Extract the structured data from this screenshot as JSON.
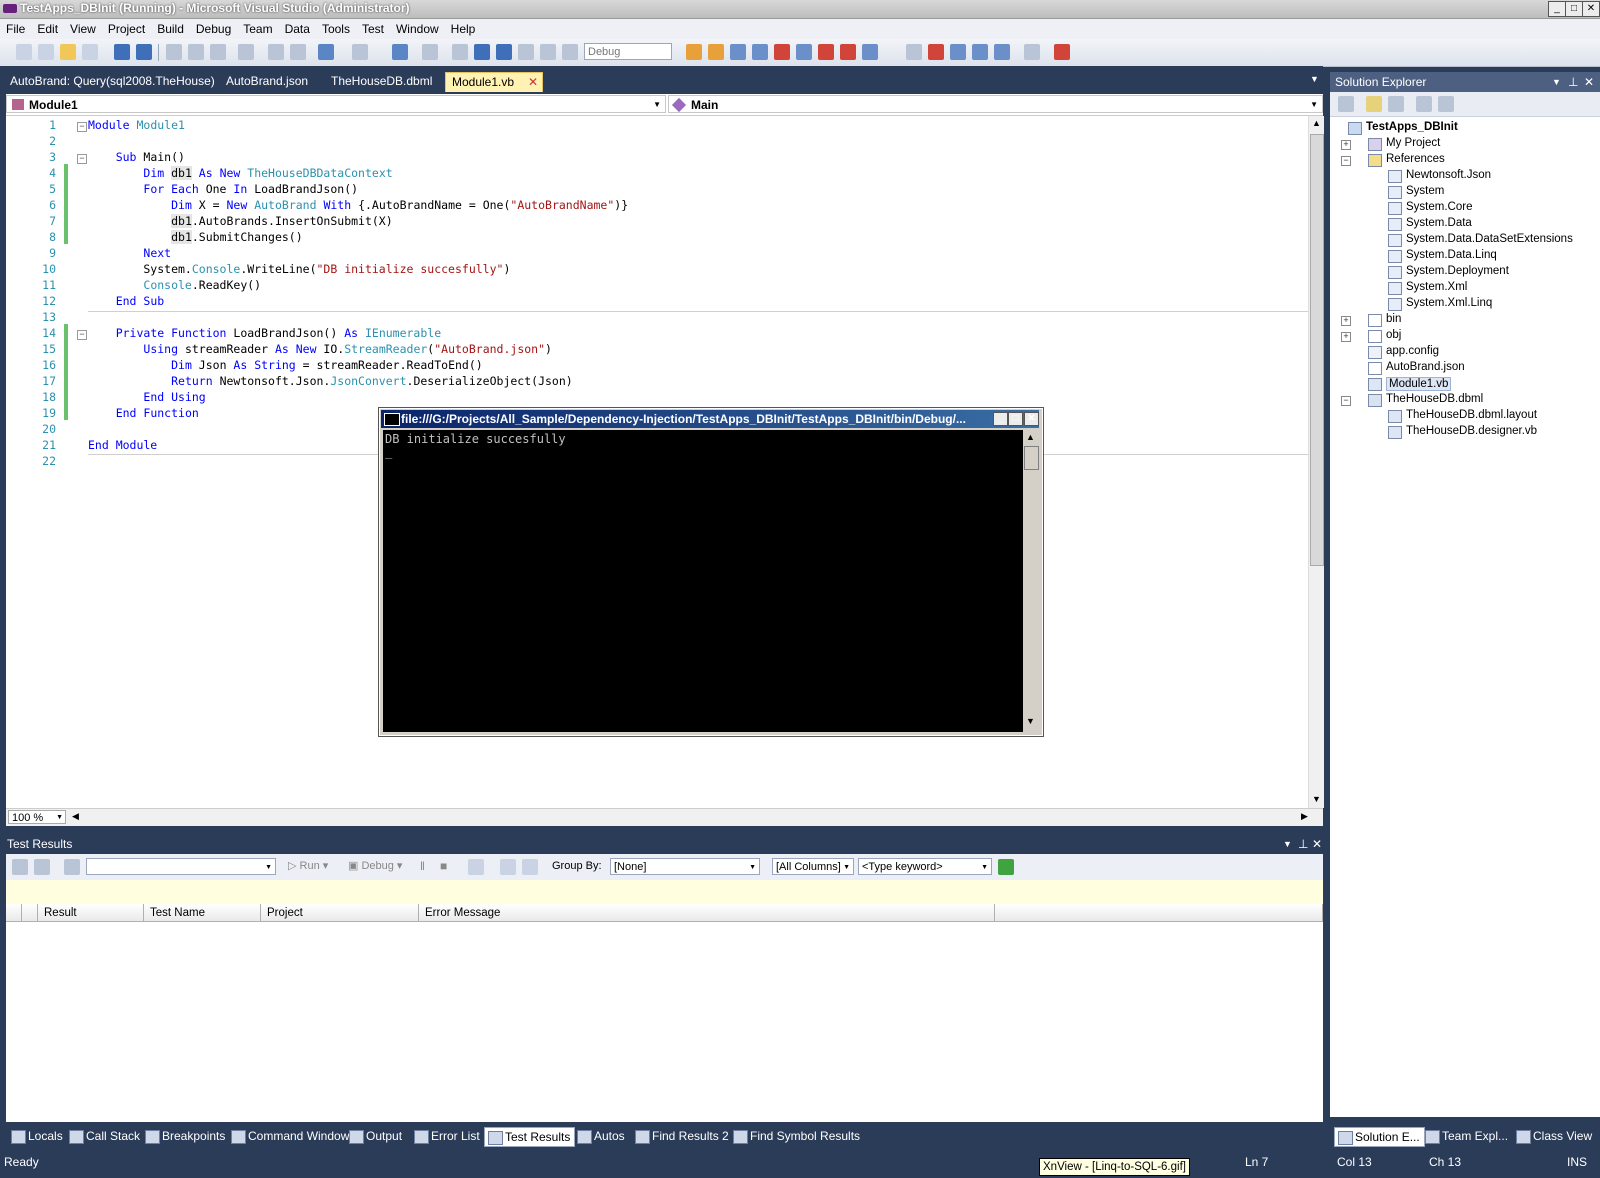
{
  "window": {
    "title": "TestApps_DBInit (Running) - Microsoft Visual Studio (Administrator)",
    "min": "_",
    "max": "□",
    "close": "✕"
  },
  "menu": [
    "File",
    "Edit",
    "View",
    "Project",
    "Build",
    "Debug",
    "Team",
    "Data",
    "Tools",
    "Test",
    "Window",
    "Help"
  ],
  "toolbar": {
    "config_combo": "Debug"
  },
  "doc_tabs": [
    {
      "label": "AutoBrand: Query(sql2008.TheHouse)",
      "active": false
    },
    {
      "label": "AutoBrand.json",
      "active": false
    },
    {
      "label": "TheHouseDB.dbml",
      "active": false
    },
    {
      "label": "Module1.vb",
      "active": true
    }
  ],
  "editor": {
    "nav_left": "Module1",
    "nav_right": "Main",
    "zoom": "100 %",
    "line_numbers": [
      "1",
      "2",
      "3",
      "4",
      "5",
      "6",
      "7",
      "8",
      "9",
      "10",
      "11",
      "12",
      "13",
      "14",
      "15",
      "16",
      "17",
      "18",
      "19",
      "20",
      "21",
      "22"
    ],
    "lines": [
      [
        [
          "kw",
          "Module "
        ],
        [
          "ty",
          "Module1"
        ]
      ],
      [],
      [
        [
          "t",
          "    "
        ],
        [
          "kw",
          "Sub "
        ],
        [
          "t",
          "Main()"
        ]
      ],
      [
        [
          "t",
          "        "
        ],
        [
          "kw",
          "Dim "
        ],
        [
          "hl",
          "db1"
        ],
        [
          "kw",
          " As New "
        ],
        [
          "ty",
          "TheHouseDBDataContext"
        ]
      ],
      [
        [
          "t",
          "        "
        ],
        [
          "kw",
          "For Each "
        ],
        [
          "t",
          "One "
        ],
        [
          "kw",
          "In "
        ],
        [
          "t",
          "LoadBrandJson()"
        ]
      ],
      [
        [
          "t",
          "            "
        ],
        [
          "kw",
          "Dim "
        ],
        [
          "t",
          "X = "
        ],
        [
          "kw",
          "New "
        ],
        [
          "ty",
          "AutoBrand "
        ],
        [
          "kw",
          "With "
        ],
        [
          "t",
          "{.AutoBrandName = One("
        ],
        [
          "st",
          "\"AutoBrandName\""
        ],
        [
          "t",
          ")}"
        ]
      ],
      [
        [
          "t",
          "            "
        ],
        [
          "hl",
          "db1"
        ],
        [
          "t",
          ".AutoBrands.InsertOnSubmit(X)"
        ]
      ],
      [
        [
          "t",
          "            "
        ],
        [
          "hl",
          "db1"
        ],
        [
          "t",
          ".SubmitChanges()"
        ]
      ],
      [
        [
          "t",
          "        "
        ],
        [
          "kw",
          "Next"
        ]
      ],
      [
        [
          "t",
          "        System."
        ],
        [
          "ty",
          "Console"
        ],
        [
          "t",
          ".WriteLine("
        ],
        [
          "st",
          "\"DB initialize succesfully\""
        ],
        [
          "t",
          ")"
        ]
      ],
      [
        [
          "t",
          "        "
        ],
        [
          "ty",
          "Console"
        ],
        [
          "t",
          ".ReadKey()"
        ]
      ],
      [
        [
          "t",
          "    "
        ],
        [
          "kw",
          "End Sub"
        ]
      ],
      [],
      [
        [
          "t",
          "    "
        ],
        [
          "kw",
          "Private Function "
        ],
        [
          "t",
          "LoadBrandJson() "
        ],
        [
          "kw",
          "As "
        ],
        [
          "ty",
          "IEnumerable"
        ]
      ],
      [
        [
          "t",
          "        "
        ],
        [
          "kw",
          "Using "
        ],
        [
          "t",
          "streamReader "
        ],
        [
          "kw",
          "As New "
        ],
        [
          "t",
          "IO."
        ],
        [
          "ty",
          "StreamReader"
        ],
        [
          "t",
          "("
        ],
        [
          "st",
          "\"AutoBrand.json\""
        ],
        [
          "t",
          ")"
        ]
      ],
      [
        [
          "t",
          "            "
        ],
        [
          "kw",
          "Dim "
        ],
        [
          "t",
          "Json "
        ],
        [
          "kw",
          "As String "
        ],
        [
          "t",
          "= streamReader.ReadToEnd()"
        ]
      ],
      [
        [
          "t",
          "            "
        ],
        [
          "kw",
          "Return "
        ],
        [
          "t",
          "Newtonsoft.Json."
        ],
        [
          "ty",
          "JsonConvert"
        ],
        [
          "t",
          ".DeserializeObject(Json)"
        ]
      ],
      [
        [
          "t",
          "        "
        ],
        [
          "kw",
          "End Using"
        ]
      ],
      [
        [
          "t",
          "    "
        ],
        [
          "kw",
          "End Function"
        ]
      ],
      [],
      [
        [
          "kw",
          "End Module"
        ]
      ],
      []
    ]
  },
  "console": {
    "title": "file:///G:/Projects/All_Sample/Dependency-Injection/TestApps_DBInit/TestApps_DBInit/bin/Debug/...",
    "output": "DB initialize succesfully",
    "cursor": "_"
  },
  "solution_explorer": {
    "title": "Solution Explorer",
    "nodes": [
      {
        "label": "TestApps_DBInit",
        "bold": true
      },
      {
        "label": "My Project"
      },
      {
        "label": "References"
      },
      {
        "label": "Newtonsoft.Json"
      },
      {
        "label": "System"
      },
      {
        "label": "System.Core"
      },
      {
        "label": "System.Data"
      },
      {
        "label": "System.Data.DataSetExtensions"
      },
      {
        "label": "System.Data.Linq"
      },
      {
        "label": "System.Deployment"
      },
      {
        "label": "System.Xml"
      },
      {
        "label": "System.Xml.Linq"
      },
      {
        "label": "bin"
      },
      {
        "label": "obj"
      },
      {
        "label": "app.config"
      },
      {
        "label": "AutoBrand.json"
      },
      {
        "label": "Module1.vb",
        "selected": true
      },
      {
        "label": "TheHouseDB.dbml"
      },
      {
        "label": "TheHouseDB.dbml.layout"
      },
      {
        "label": "TheHouseDB.designer.vb"
      }
    ]
  },
  "test_results": {
    "title": "Test Results",
    "run": "Run",
    "debug": "Debug",
    "group_by_label": "Group By:",
    "group_by_value": "[None]",
    "columns_value": "[All Columns]",
    "keyword_placeholder": "<Type keyword>",
    "headers": [
      "Result",
      "Test Name",
      "Project",
      "Error Message"
    ]
  },
  "bottom_tabs": [
    "Locals",
    "Call Stack",
    "Breakpoints",
    "Command Window",
    "Output",
    "Error List",
    "Test Results",
    "Autos",
    "Find Results 2",
    "Find Symbol Results"
  ],
  "right_bottom_tabs": [
    "Solution E...",
    "Team Expl...",
    "Class View"
  ],
  "status": {
    "text": "Ready",
    "ln": "Ln 7",
    "col": "Col 13",
    "ch": "Ch 13",
    "mode": "INS"
  },
  "tooltip": "XnView - [Linq-to-SQL-6.gif]",
  "colors": {
    "chrome": "#2b3c59",
    "keyword": "#0000ff",
    "type": "#2b91af",
    "string": "#a31515",
    "active_tab": "#fff2b2"
  }
}
